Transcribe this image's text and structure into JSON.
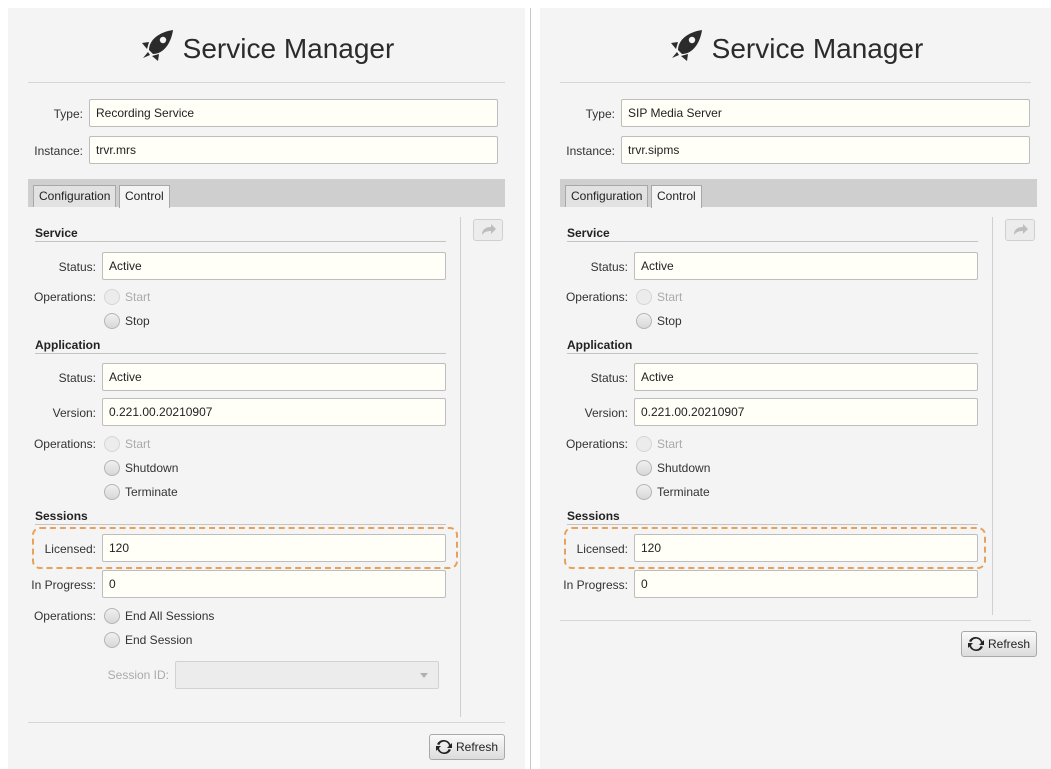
{
  "left": {
    "title": "Service Manager",
    "type_label": "Type:",
    "type_value": "Recording Service",
    "instance_label": "Instance:",
    "instance_value": "trvr.mrs",
    "tabs": [
      "Configuration",
      "Control"
    ],
    "active_tab": "Control",
    "service_header": "Service",
    "service_status_label": "Status:",
    "service_status_value": "Active",
    "service_ops_label": "Operations:",
    "service_ops": [
      "Start",
      "Stop"
    ],
    "app_header": "Application",
    "app_status_label": "Status:",
    "app_status_value": "Active",
    "app_version_label": "Version:",
    "app_version_value": "0.221.00.20210907",
    "app_ops_label": "Operations:",
    "app_ops": [
      "Start",
      "Shutdown",
      "Terminate"
    ],
    "sessions_header": "Sessions",
    "licensed_label": "Licensed:",
    "licensed_value": "120",
    "inprogress_label": "In Progress:",
    "inprogress_value": "0",
    "sessions_ops_label": "Operations:",
    "sessions_ops": [
      "End All Sessions",
      "End Session"
    ],
    "session_id_label": "Session ID:",
    "refresh_label": "Refresh"
  },
  "right": {
    "title": "Service Manager",
    "type_label": "Type:",
    "type_value": "SIP Media Server",
    "instance_label": "Instance:",
    "instance_value": "trvr.sipms",
    "tabs": [
      "Configuration",
      "Control"
    ],
    "active_tab": "Control",
    "service_header": "Service",
    "service_status_label": "Status:",
    "service_status_value": "Active",
    "service_ops_label": "Operations:",
    "service_ops": [
      "Start",
      "Stop"
    ],
    "app_header": "Application",
    "app_status_label": "Status:",
    "app_status_value": "Active",
    "app_version_label": "Version:",
    "app_version_value": "0.221.00.20210907",
    "app_ops_label": "Operations:",
    "app_ops": [
      "Start",
      "Shutdown",
      "Terminate"
    ],
    "sessions_header": "Sessions",
    "licensed_label": "Licensed:",
    "licensed_value": "120",
    "inprogress_label": "In Progress:",
    "inprogress_value": "0",
    "refresh_label": "Refresh"
  },
  "colors": {
    "highlight": "#e8a15a",
    "field_bg": "#fffef7",
    "panel_bg": "#f4f4f4"
  }
}
